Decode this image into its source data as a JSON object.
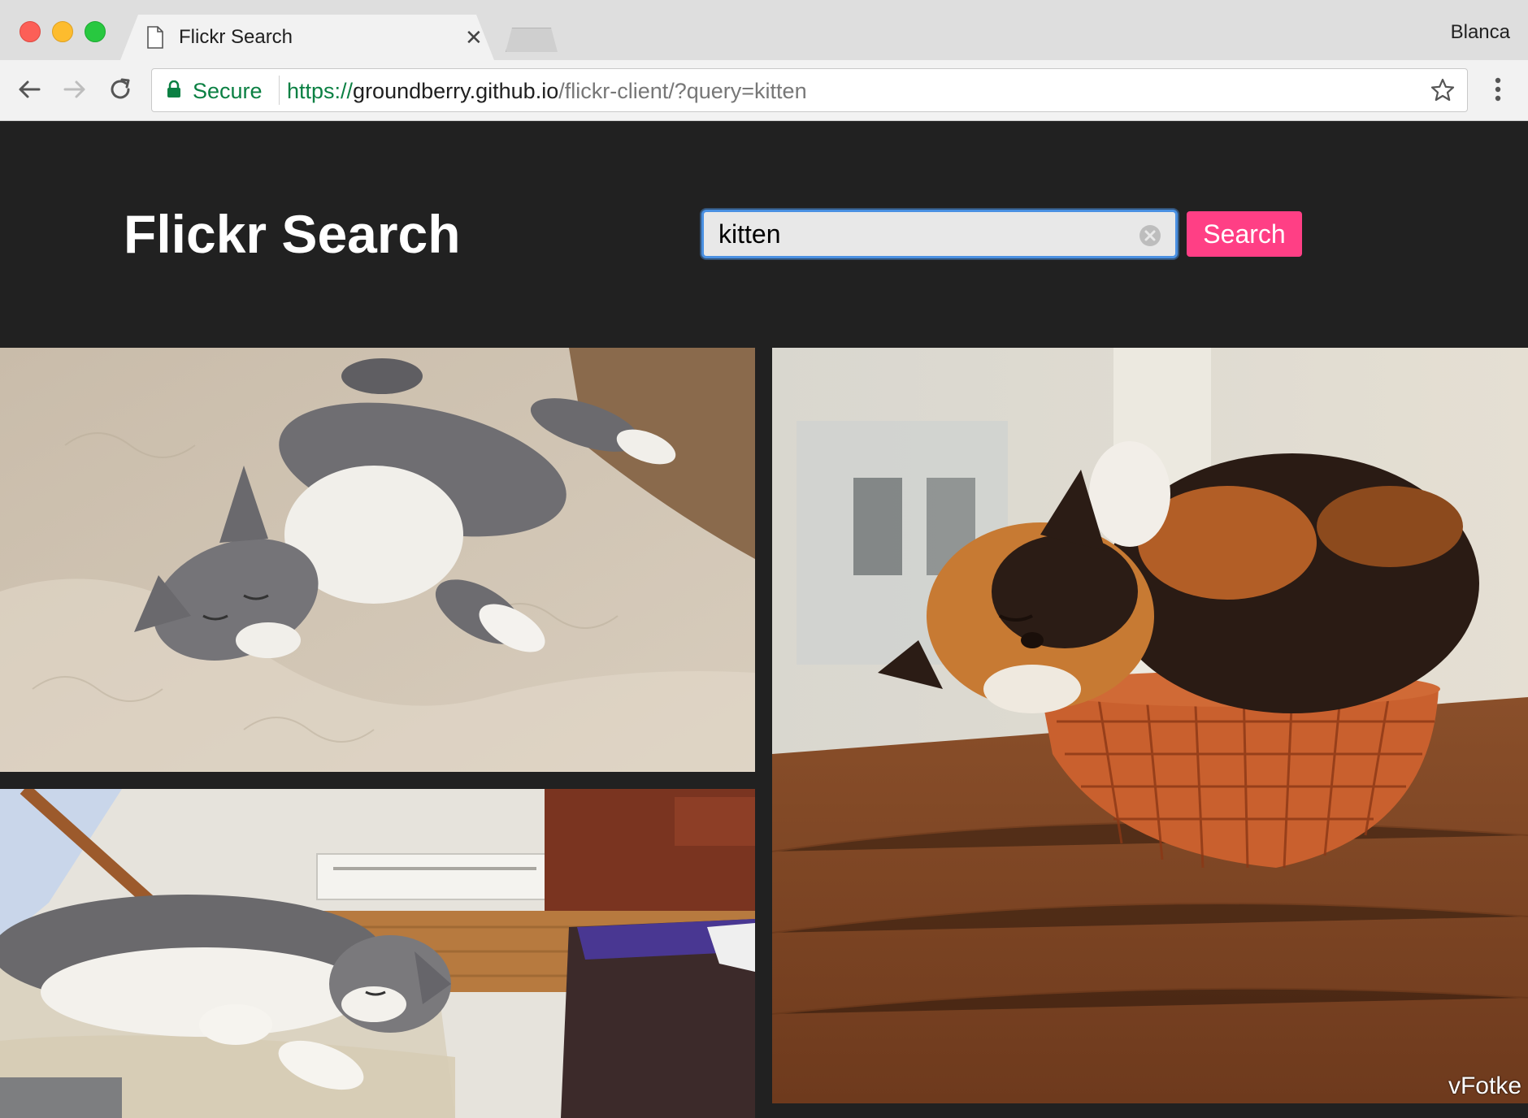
{
  "browser": {
    "tab_title": "Flickr Search",
    "profile_name": "Blanca",
    "secure_label": "Secure",
    "url_scheme": "https://",
    "url_host": "groundberry.github.io",
    "url_path": "/flickr-client/?query=kitten"
  },
  "page": {
    "title": "Flickr Search",
    "search_value": "kitten",
    "search_button": "Search",
    "accent_color": "#ff3f85",
    "background_color": "#212121"
  },
  "photos": [
    {
      "subject": "grey and white cat lying on a bed"
    },
    {
      "subject": "grey and white cat sleeping on a couch"
    },
    {
      "subject": "calico cat curled in a wicker basket",
      "watermark": "vFotke"
    }
  ]
}
